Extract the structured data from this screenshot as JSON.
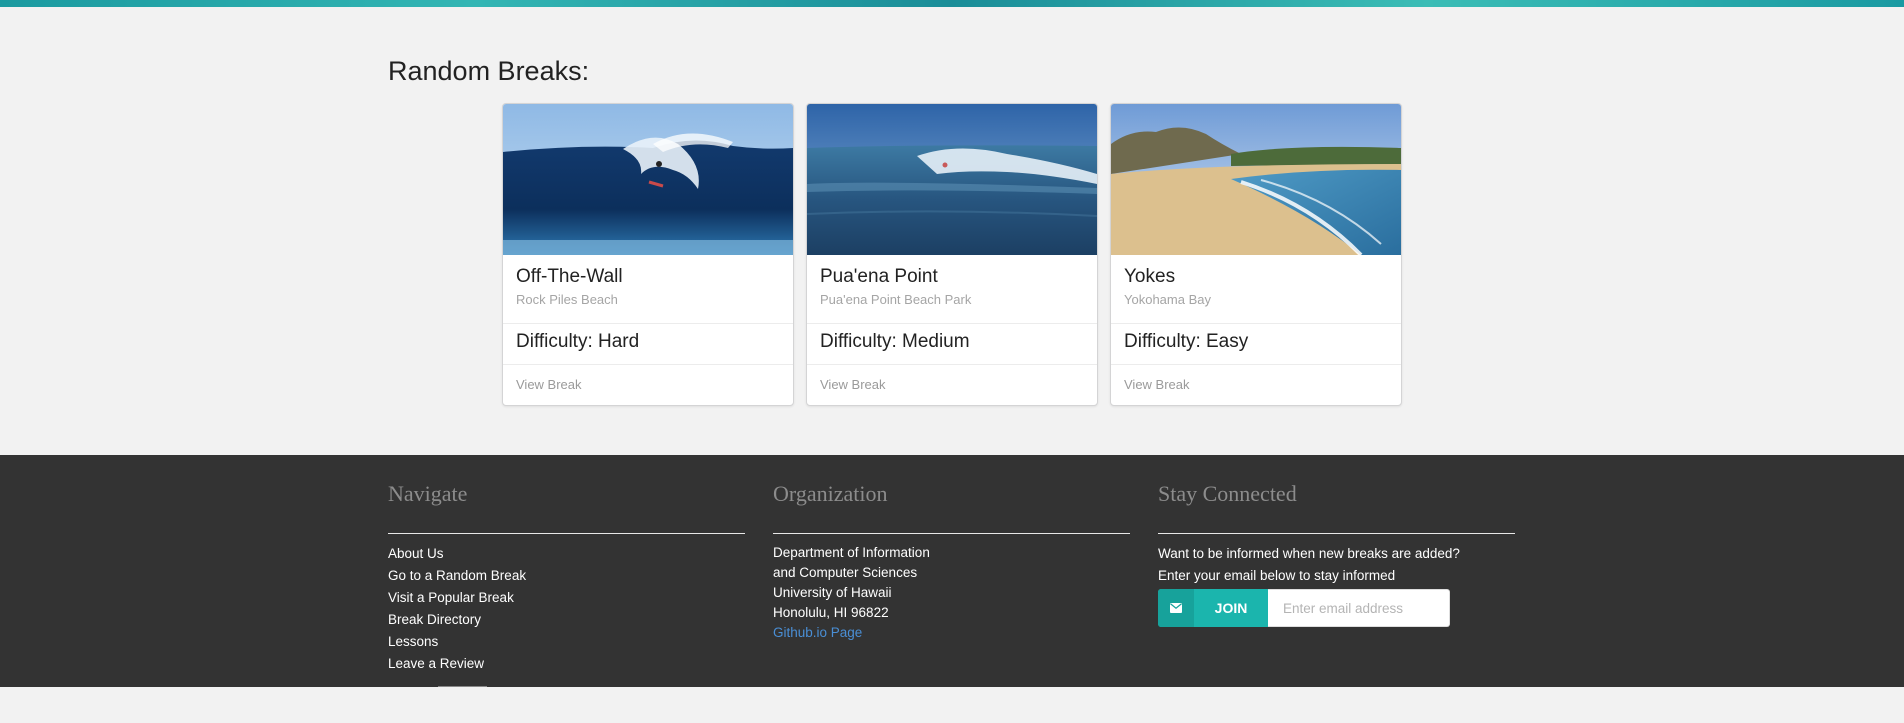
{
  "section": {
    "title": "Random Breaks:"
  },
  "cards": [
    {
      "title": "Off-The-Wall",
      "subtitle": "Rock Piles Beach",
      "difficulty": "Difficulty: Hard",
      "link": "View Break",
      "image": "barrel-wave-surfer-photo"
    },
    {
      "title": "Pua'ena Point",
      "subtitle": "Pua'ena Point Beach Park",
      "difficulty": "Difficulty: Medium",
      "link": "View Break",
      "image": "wave-surfer-photo"
    },
    {
      "title": "Yokes",
      "subtitle": "Yokohama Bay",
      "difficulty": "Difficulty: Easy",
      "link": "View Break",
      "image": "beach-cliffs-photo"
    }
  ],
  "footer": {
    "navigate": {
      "heading": "Navigate",
      "links": [
        "About Us",
        "Go to a Random Break",
        "Visit a Popular Break",
        "Break Directory",
        "Lessons",
        "Leave a Review"
      ]
    },
    "organization": {
      "heading": "Organization",
      "lines": [
        "Department of Information",
        "and Computer Sciences",
        "University of Hawaii",
        "Honolulu, HI 96822"
      ],
      "link": "Github.io Page"
    },
    "connected": {
      "heading": "Stay Connected",
      "lines": [
        "Want to be informed when new breaks are added?",
        "Enter your email below to stay informed"
      ],
      "join_label": "JOIN",
      "join_icon": "envelope-icon",
      "email_placeholder": "Enter email address"
    }
  },
  "colors": {
    "footer_bg": "#333333",
    "accent": "#1bb5ad",
    "link": "#4a8fd6",
    "page_bg": "#f2f2f2"
  }
}
